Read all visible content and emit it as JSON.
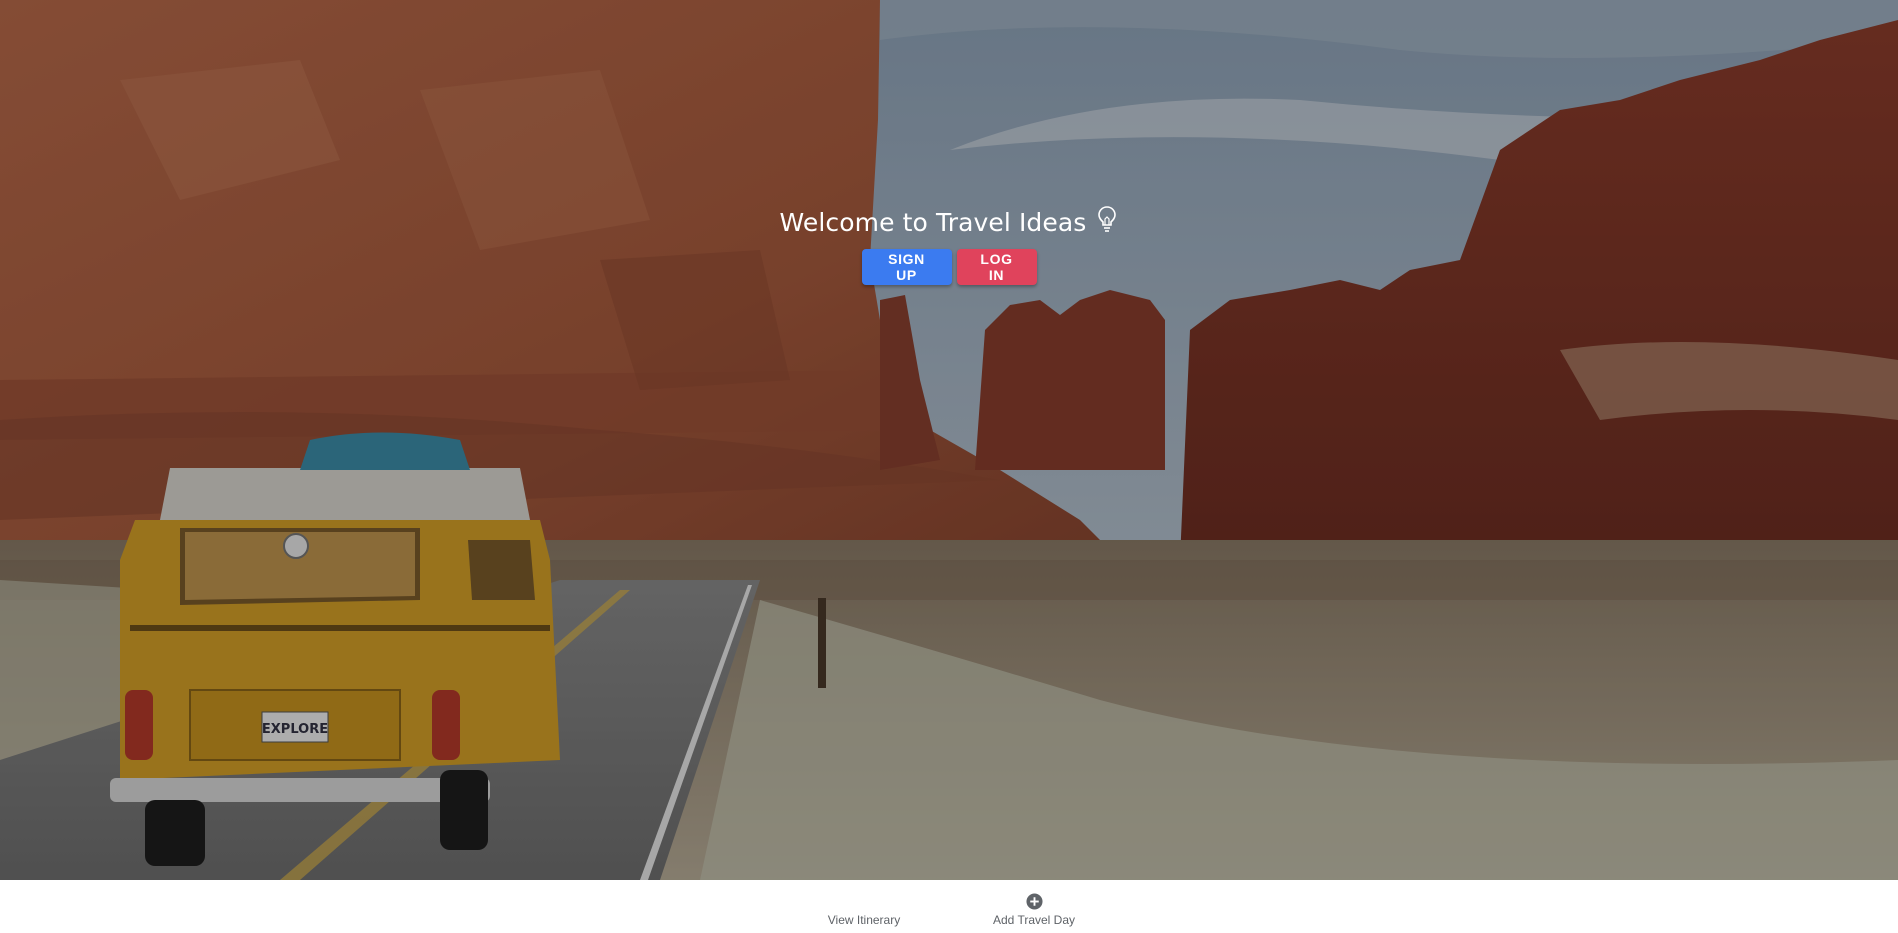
{
  "hero": {
    "title": "Welcome to Travel Ideas",
    "title_icon": "lightbulb-icon",
    "signup_label": "SIGN UP",
    "login_label": "LOG IN",
    "license_plate": "EXPLORE"
  },
  "bottom_nav": {
    "items": [
      {
        "label": "View Itinerary",
        "icon": null
      },
      {
        "label": "Add Travel Day",
        "icon": "add-circle-icon"
      }
    ]
  },
  "colors": {
    "signup": "#3b7bf0",
    "login": "#e0435c",
    "nav_text": "#5f6368"
  }
}
